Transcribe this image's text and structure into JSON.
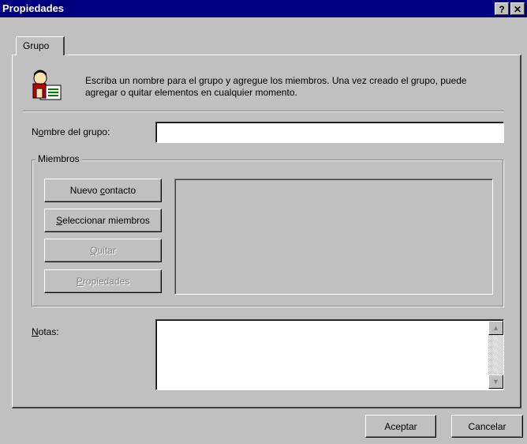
{
  "window": {
    "title": "Propiedades",
    "help_btn": "?",
    "close_btn": "✕"
  },
  "tabs": [
    {
      "label": "Grupo"
    }
  ],
  "intro": {
    "icon": "contacts-group-icon",
    "text": "Escriba un nombre para el grupo y agregue los miembros. Una vez creado el grupo, puede agregar o quitar elementos en cualquier momento."
  },
  "group_name": {
    "label_pre": "N",
    "label_mn": "o",
    "label_post": "mbre del grupo:",
    "value": ""
  },
  "members": {
    "legend": "Miembros",
    "buttons": [
      {
        "pre": "Nuevo ",
        "mn": "c",
        "post": "ontacto",
        "enabled": true
      },
      {
        "pre": "",
        "mn": "S",
        "post": "eleccionar miembros",
        "enabled": true
      },
      {
        "pre": "",
        "mn": "Q",
        "post": "uitar",
        "enabled": false
      },
      {
        "pre": "",
        "mn": "P",
        "post": "ropiedades",
        "enabled": false
      }
    ]
  },
  "notes": {
    "label_mn": "N",
    "label_post": "otas:",
    "value": "",
    "scroll_up": "▲",
    "scroll_down": "▼"
  },
  "footer": {
    "ok": "Aceptar",
    "cancel": "Cancelar"
  }
}
